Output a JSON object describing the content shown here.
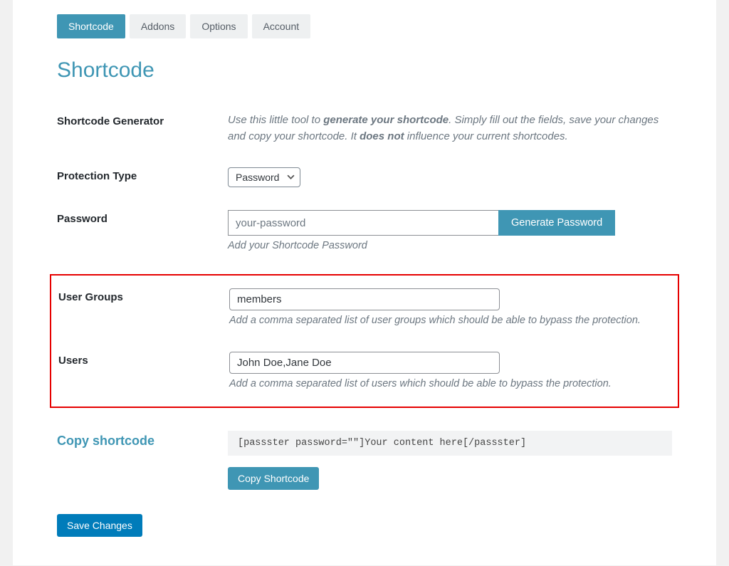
{
  "tabs": {
    "shortcode": "Shortcode",
    "addons": "Addons",
    "options": "Options",
    "account": "Account"
  },
  "page_title": "Shortcode",
  "shortcode_generator": {
    "label": "Shortcode Generator",
    "intro_pre": "Use this little tool to ",
    "intro_bold1": "generate your shortcode",
    "intro_mid": ". Simply fill out the fields, save your changes and copy your shortcode. It ",
    "intro_bold2": "does not",
    "intro_post": " influence your current shortcodes."
  },
  "protection_type": {
    "label": "Protection Type",
    "value": "Password"
  },
  "password": {
    "label": "Password",
    "value": "your-password",
    "button": "Generate Password",
    "hint": "Add your Shortcode Password"
  },
  "user_groups": {
    "label": "User Groups",
    "value": "members",
    "hint": "Add a comma separated list of user groups which should be able to bypass the protection."
  },
  "users": {
    "label": "Users",
    "value": "John Doe,Jane Doe",
    "hint": "Add a comma separated list of users which should be able to bypass the protection."
  },
  "copy_shortcode": {
    "label": "Copy shortcode",
    "code": "[passster password=\"\"]Your content here[/passster]",
    "button": "Copy Shortcode"
  },
  "save_button": "Save Changes"
}
